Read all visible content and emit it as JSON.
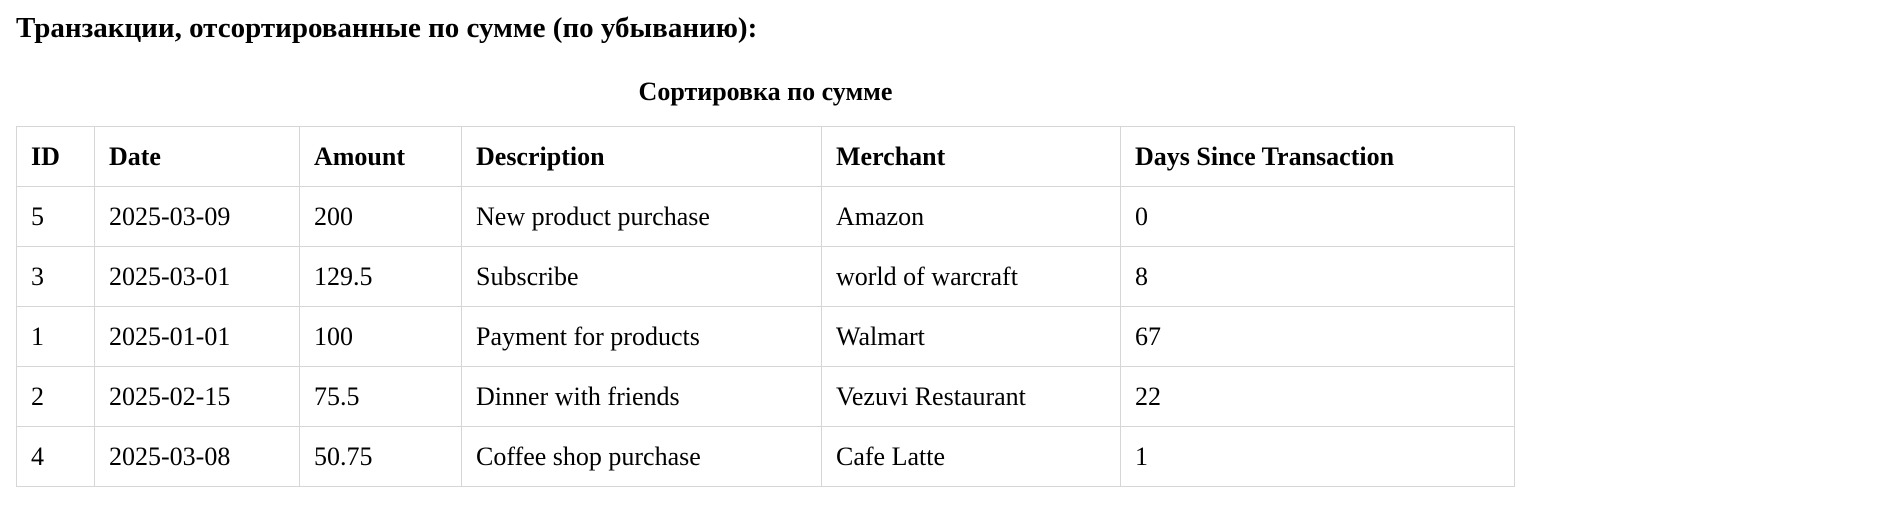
{
  "heading": "Транзакции, отсортированные по сумме (по убыванию):",
  "table": {
    "caption": "Сортировка по сумме",
    "columns": [
      "ID",
      "Date",
      "Amount",
      "Description",
      "Merchant",
      "Days Since Transaction"
    ],
    "rows": [
      [
        "5",
        "2025-03-09",
        "200",
        "New product purchase",
        "Amazon",
        "0"
      ],
      [
        "3",
        "2025-03-01",
        "129.5",
        "Subscribe",
        "world of warcraft",
        "8"
      ],
      [
        "1",
        "2025-01-01",
        "100",
        "Payment for products",
        "Walmart",
        "67"
      ],
      [
        "2",
        "2025-02-15",
        "75.5",
        "Dinner with friends",
        "Vezuvi Restaurant",
        "22"
      ],
      [
        "4",
        "2025-03-08",
        "50.75",
        "Coffee shop purchase",
        "Cafe Latte",
        "1"
      ]
    ]
  }
}
